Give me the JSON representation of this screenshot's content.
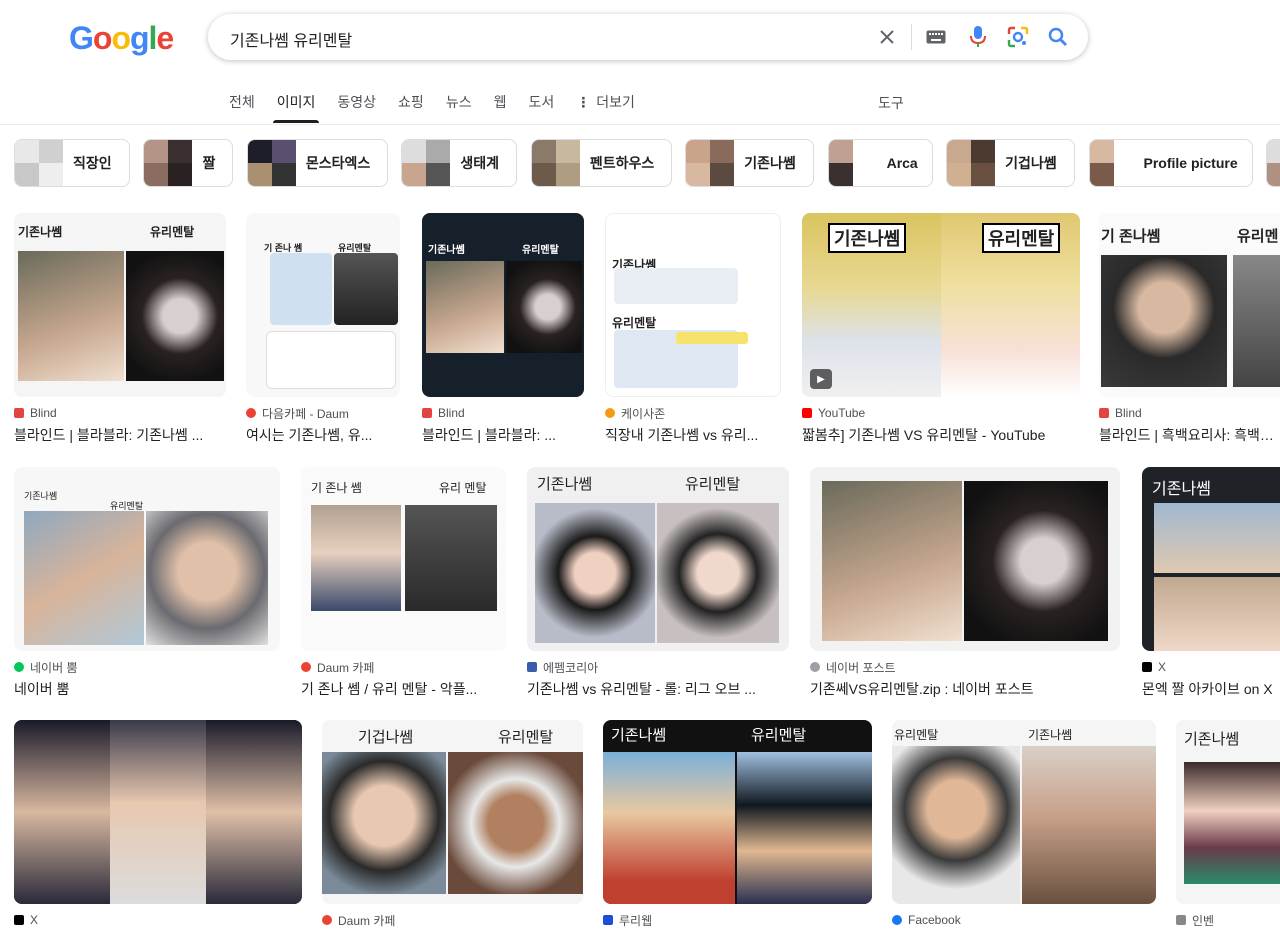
{
  "logo": "Google",
  "search": {
    "query": "기존나쎔 유리멘탈"
  },
  "icons": {
    "clear": "close-icon",
    "keyboard": "keyboard-icon",
    "mic": "mic-icon",
    "lens": "lens-icon",
    "search": "search-icon"
  },
  "tabs": [
    "전체",
    "이미지",
    "동영상",
    "쇼핑",
    "뉴스",
    "웹",
    "도서",
    "더보기"
  ],
  "tools": "도구",
  "chips": [
    "직장인",
    "짤",
    "몬스타엑스",
    "생태계",
    "펜트하우스",
    "기존나쎔",
    "Arca",
    "기겁나쎔",
    "Profile picture"
  ],
  "row1": [
    {
      "source": "Blind",
      "title": "블라인드 | 블라블라: 기존나쎔 ...",
      "tag_left": "기존나쎔",
      "tag_right": "유리멘탈",
      "favicon_color": "#e34343"
    },
    {
      "source": "다음카페 - Daum",
      "title": "여시는 기존나쎔, 유...",
      "tag_left": "기 존나 쎔",
      "tag_right": "유리멘탈",
      "favicon_color": "#ea4335"
    },
    {
      "source": "Blind",
      "title": "블라인드 | 블라블라: ...",
      "tag_left": "기존나쎔",
      "tag_right": "유리멘탈",
      "favicon_color": "#e34343"
    },
    {
      "source": "케이사존",
      "title": "직장내 기존나쎔 vs 유리...",
      "tag_left": "기존나쎔",
      "tag_right": "유리멘탈",
      "favicon_color": "#f39c12"
    },
    {
      "source": "YouTube",
      "title": "짧봄추] 기존나쎔 VS 유리멘탈 - YouTube",
      "tag_left": "기존나쎔",
      "tag_right": "유리멘탈",
      "favicon_color": "#ff0000"
    },
    {
      "source": "Blind",
      "title": "블라인드 | 흑백요리사: 흑백요리",
      "tag_left": "기 존나쎔",
      "tag_right": "유리멘",
      "favicon_color": "#e34343"
    }
  ],
  "row2": [
    {
      "source": "네이버 뿜",
      "title": "네이버 뿜",
      "tag_left": "기존나쎔",
      "tag_right": "유리멘탈",
      "favicon_color": "#03c75a"
    },
    {
      "source": "Daum 카페",
      "title": "기 존나 쎔 / 유리 멘탈 - 악플...",
      "tag_left": "기 존나 쎔",
      "tag_right": "유리 멘탈",
      "favicon_color": "#ea4335"
    },
    {
      "source": "에펨코리아",
      "title": "기존나쎔 vs 유리멘탈 - 롤: 리그 오브 ...",
      "tag_left": "기존나쎔",
      "tag_right": "유리멘탈",
      "favicon_color": "#3b5bab"
    },
    {
      "source": "네이버 포스트",
      "title": "기존쎄VS유리멘탈.zip : 네이버 포스트",
      "tag_left": "",
      "tag_right": "",
      "favicon_color": "#9aa0a6"
    },
    {
      "source": "X",
      "title": "몬엑 짤 아카이브 on X",
      "tag_left": "기존나쎔",
      "tag_right": "",
      "favicon_color": "#000000"
    }
  ],
  "row3": [
    {
      "source": "X",
      "tag_left": "",
      "tag_right": "",
      "favicon_color": "#000000"
    },
    {
      "source": "Daum 카페",
      "tag_left": "기겁나쎔",
      "tag_right": "유리멘탈",
      "favicon_color": "#ea4335"
    },
    {
      "source": "루리웹",
      "tag_left": "기존나쎔",
      "tag_right": "유리멘탈",
      "favicon_color": "#1d4ed8"
    },
    {
      "source": "Facebook",
      "tag_left": "유리멘탈",
      "tag_right": "기존나쎔",
      "favicon_color": "#1877f2"
    },
    {
      "source": "인벤",
      "tag_left": "기존나쎔",
      "tag_right": "",
      "favicon_color": "#888888"
    }
  ]
}
